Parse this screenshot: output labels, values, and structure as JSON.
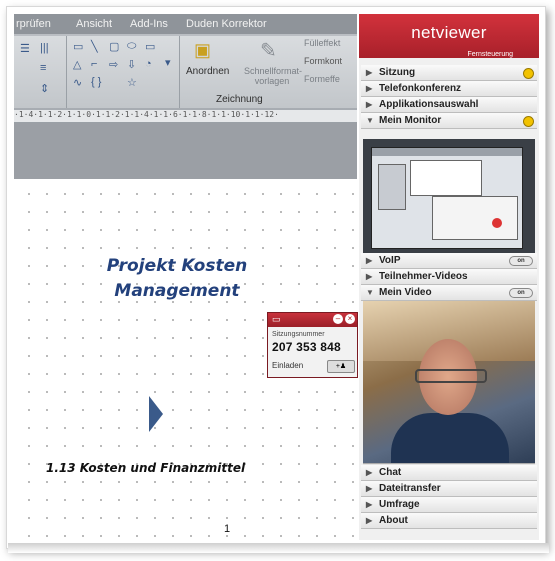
{
  "word": {
    "tabs": [
      "rprüfen",
      "Ansicht",
      "Add-Ins",
      "Duden Korrektor"
    ],
    "ribbon": {
      "arrange_label": "Anordnen",
      "quickformat_label": "Schnellformat-\nvorlagen",
      "group_label": "Zeichnung",
      "fill_label": "Fülleffekt",
      "outline_label": "Formkont",
      "effects_label": "Formeffe"
    },
    "ruler": "·1·4·1·1·2·1·1·0·1·1·2·1·1·4·1·1·6·1·1·8·1·1·10·1·1·12·",
    "slide": {
      "title_line1": "Projekt Kosten",
      "title_line2": "Management",
      "subtitle": "1.13 Kosten und Finanzmittel",
      "page_number": "1"
    }
  },
  "session_popup": {
    "label": "Sitzungsnummer",
    "number": "207 353 848",
    "invite_label": "Einladen"
  },
  "netviewer": {
    "logo": "netviewer",
    "subtitle": "Fernsteuerung",
    "sections_top": [
      {
        "label": "Sitzung",
        "arrow": "▶"
      },
      {
        "label": "Telefonkonferenz",
        "arrow": "▶"
      },
      {
        "label": "Applikationsauswahl",
        "arrow": "▶"
      },
      {
        "label": "Mein Monitor",
        "arrow": "▼"
      }
    ],
    "sections_mid": [
      {
        "label": "VoIP",
        "arrow": "▶"
      },
      {
        "label": "Teilnehmer-Videos",
        "arrow": "▶"
      },
      {
        "label": "Mein Video",
        "arrow": "▼"
      }
    ],
    "sections_bottom": [
      {
        "label": "Chat",
        "arrow": "▶"
      },
      {
        "label": "Dateitransfer",
        "arrow": "▶"
      },
      {
        "label": "Umfrage",
        "arrow": "▶"
      },
      {
        "label": "About",
        "arrow": "▶"
      }
    ],
    "pause_label": "II"
  }
}
